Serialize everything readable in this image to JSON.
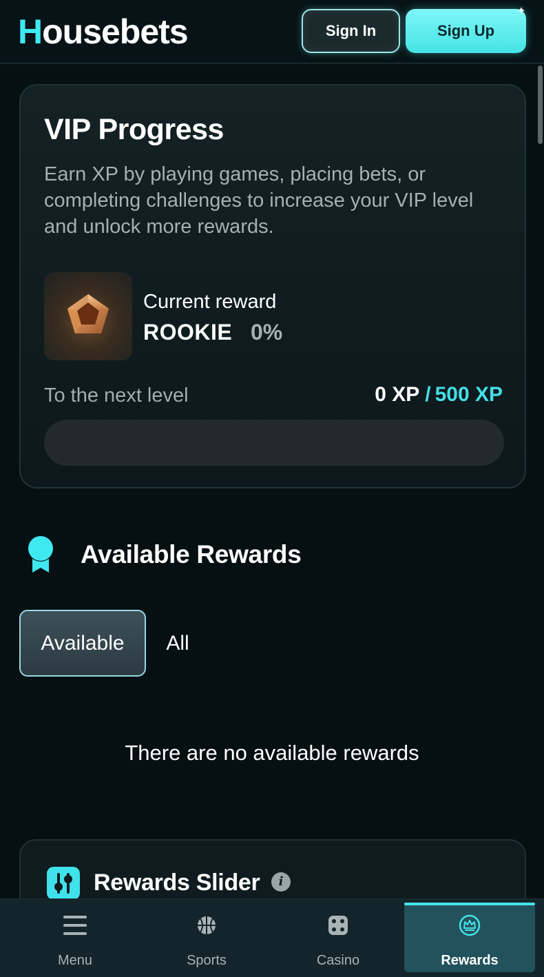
{
  "header": {
    "logo_first": "H",
    "logo_rest": "ousebets",
    "signin_label": "Sign In",
    "signup_label": "Sign Up"
  },
  "vip": {
    "title": "VIP Progress",
    "description": "Earn XP by playing games, placing bets, or completing challenges to increase your VIP level and unlock more rewards.",
    "badge_icon": "bronze-pentagon-badge-icon",
    "current_reward_label": "Current reward",
    "level_name": "ROOKIE",
    "level_percent": "0%",
    "next_level_label": "To the next level",
    "xp_current": "0 XP",
    "xp_separator": "/",
    "xp_target": "500 XP",
    "progress_fraction": 0
  },
  "available_rewards": {
    "title": "Available Rewards",
    "icon": "ribbon-award-icon",
    "tabs": [
      {
        "label": "Available",
        "active": true
      },
      {
        "label": "All",
        "active": false
      }
    ],
    "empty_message": "There are no available rewards"
  },
  "rewards_slider": {
    "title": "Rewards Slider",
    "icon": "sliders-icon",
    "info_icon": "info-icon"
  },
  "bottom_nav": {
    "items": [
      {
        "label": "Menu",
        "icon": "hamburger-menu-icon",
        "active": false
      },
      {
        "label": "Sports",
        "icon": "basketball-icon",
        "active": false
      },
      {
        "label": "Casino",
        "icon": "dice-icon",
        "active": false
      },
      {
        "label": "Rewards",
        "icon": "crown-icon",
        "active": true
      }
    ]
  },
  "colors": {
    "accent": "#43dfe6",
    "background": "#061013",
    "card": "#142225",
    "muted_text": "#a6b0b2"
  }
}
